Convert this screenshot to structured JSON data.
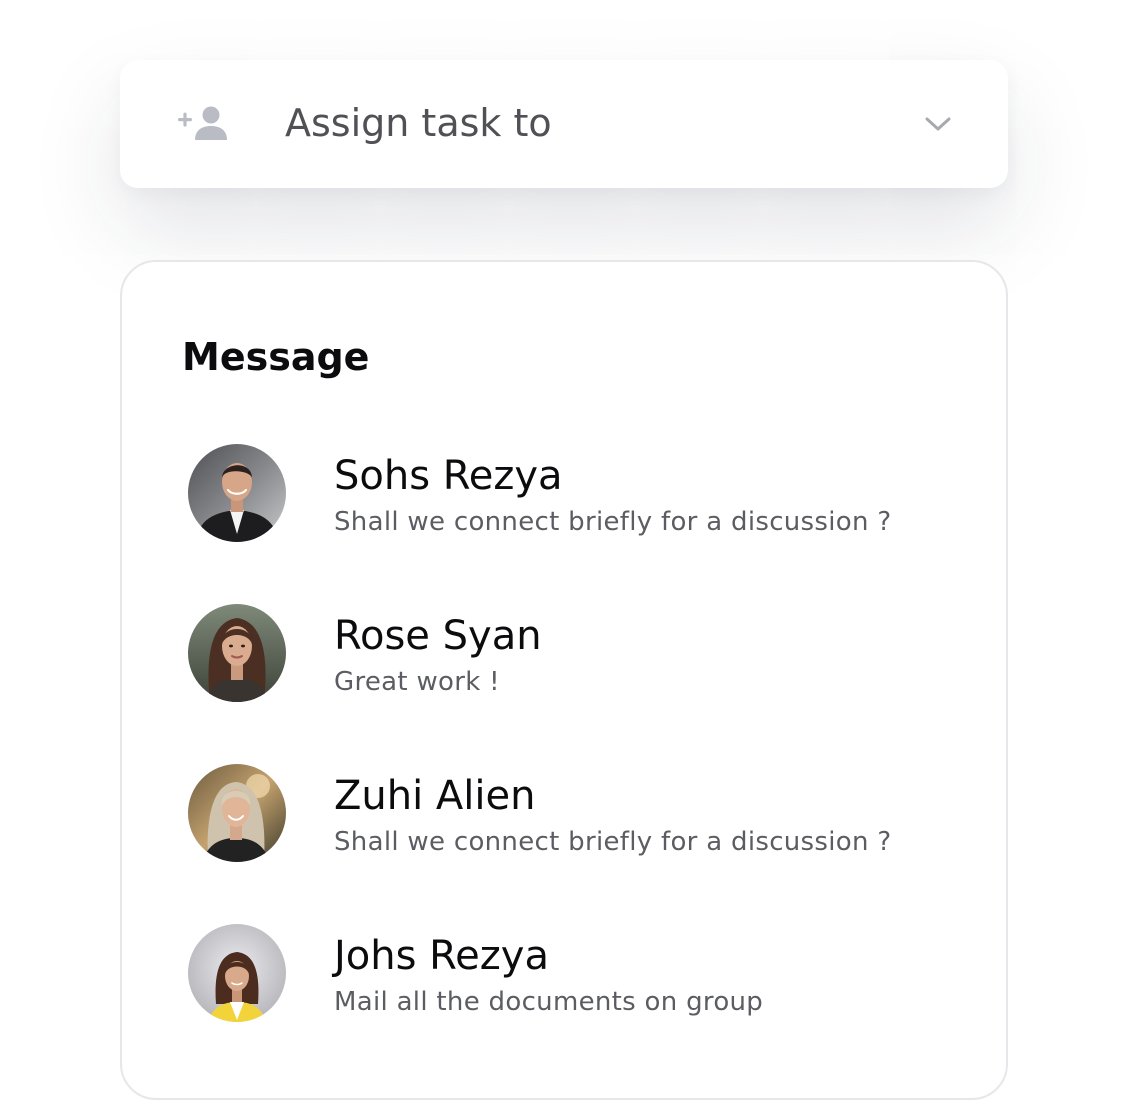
{
  "assign": {
    "label": "Assign task to",
    "icon": "add-person-icon",
    "dropdown_icon": "chevron-down-icon",
    "icon_color": "#b9bcc4"
  },
  "messages": {
    "title": "Message",
    "items": [
      {
        "name": "Sohs Rezya",
        "preview": "Shall we connect briefly for a discussion ?",
        "avatar": "avatar-man-suit"
      },
      {
        "name": "Rose Syan",
        "preview": "Great work !",
        "avatar": "avatar-woman-dark-hair"
      },
      {
        "name": "Zuhi Alien",
        "preview": "Shall we connect briefly for a discussion ?",
        "avatar": "avatar-woman-blonde"
      },
      {
        "name": "Johs Rezya",
        "preview": "Mail all the documents on group",
        "avatar": "avatar-woman-yellow-jacket"
      }
    ]
  },
  "colors": {
    "card_background": "#ffffff",
    "border": "#e6e7ea",
    "primary_text": "#0c0c0e",
    "secondary_text": "#5c5d62"
  }
}
